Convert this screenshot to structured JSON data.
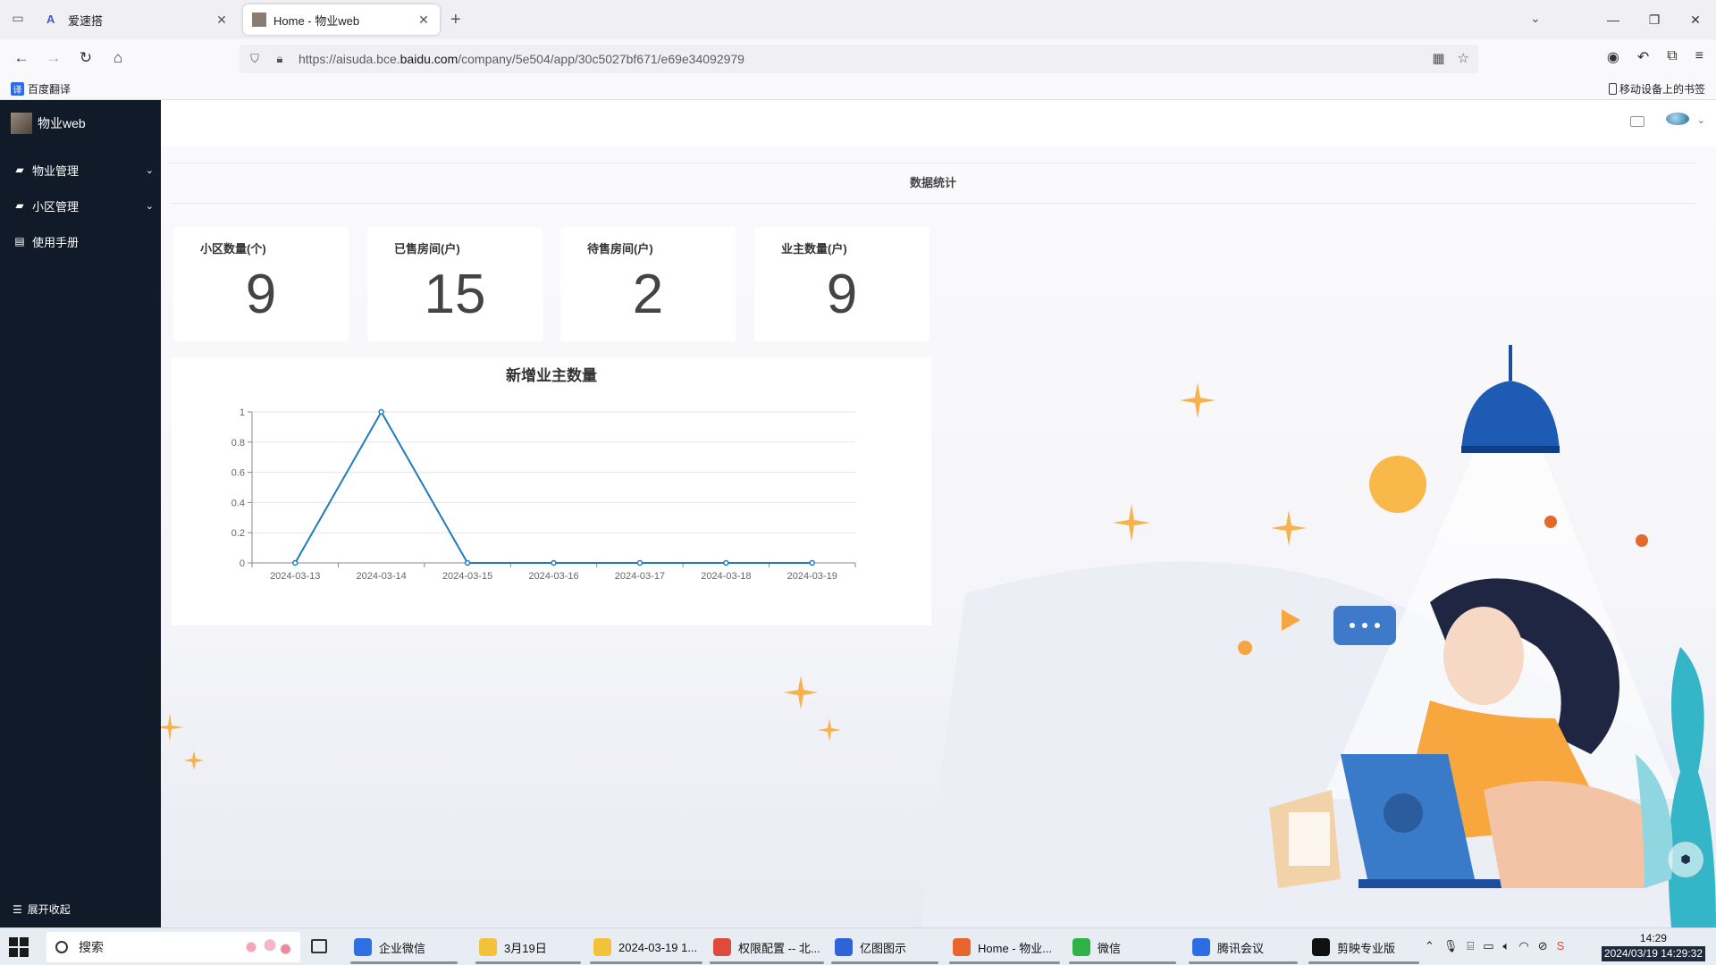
{
  "browser": {
    "tabs": [
      {
        "title": "爱速搭",
        "active": false
      },
      {
        "title": "Home - 物业web",
        "active": true
      }
    ],
    "url_prefix": "https://aisuda.bce.",
    "url_domain": "baidu.com",
    "url_path": "/company/5e504/app/30c5027bf671/e69e34092979",
    "bookmarks": {
      "left_item": "百度翻译",
      "right_item": "移动设备上的书签"
    }
  },
  "app": {
    "name": "物业web",
    "menu": [
      {
        "label": "物业管理",
        "icon": "folder-icon",
        "expandable": true
      },
      {
        "label": "小区管理",
        "icon": "folder-icon",
        "expandable": true
      },
      {
        "label": "使用手册",
        "icon": "book-icon",
        "expandable": false
      }
    ],
    "collapse_label": "展开收起",
    "section_title": "数据统计",
    "stats": [
      {
        "label": "小区数量(个)",
        "value": "9"
      },
      {
        "label": "已售房间(户)",
        "value": "15"
      },
      {
        "label": "待售房间(户)",
        "value": "2"
      },
      {
        "label": "业主数量(户)",
        "value": "9"
      }
    ]
  },
  "chart_data": {
    "type": "line",
    "title": "新增业主数量",
    "categories": [
      "2024-03-13",
      "2024-03-14",
      "2024-03-15",
      "2024-03-16",
      "2024-03-17",
      "2024-03-18",
      "2024-03-19"
    ],
    "values": [
      0,
      1,
      0,
      0,
      0,
      0,
      0
    ],
    "ylim": [
      0,
      1
    ],
    "yticks": [
      "0",
      "0.2",
      "0.4",
      "0.6",
      "0.8",
      "1"
    ],
    "grid": true,
    "line_color": "#1f7bbf"
  },
  "taskbar": {
    "search_placeholder": "搜索",
    "apps": [
      {
        "label": "企业微信",
        "color": "#2f6fe4"
      },
      {
        "label": "3月19日",
        "color": "#f2c23b"
      },
      {
        "label": "2024-03-19 1...",
        "color": "#f2c23b"
      },
      {
        "label": "权限配置 -- 北...",
        "color": "#e04a3b"
      },
      {
        "label": "亿图图示",
        "color": "#2e63d9"
      },
      {
        "label": "Home - 物业...",
        "color": "#e8662d"
      },
      {
        "label": "微信",
        "color": "#2fb349"
      },
      {
        "label": "腾讯会议",
        "color": "#2c6de3"
      },
      {
        "label": "剪映专业版",
        "color": "#111111"
      }
    ],
    "time": "14:29",
    "date": "2024/03/19 14:29:32"
  }
}
